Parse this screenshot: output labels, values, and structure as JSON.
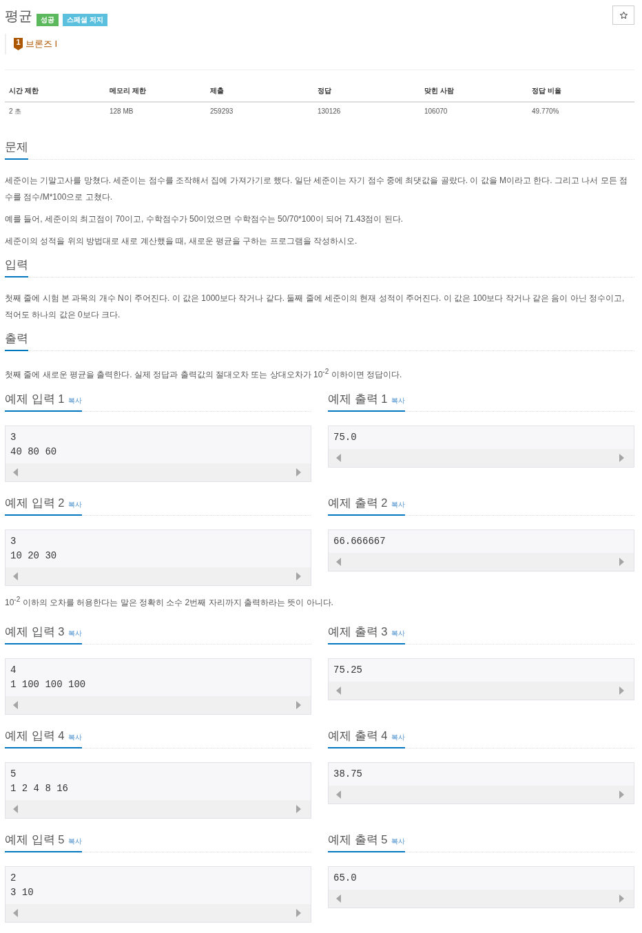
{
  "header": {
    "title": "평균",
    "badges": [
      {
        "label": "성공",
        "kind": "success"
      },
      {
        "label": "스페셜 저지",
        "kind": "info"
      }
    ],
    "starred": false
  },
  "tier": {
    "number": "1",
    "label": "브론즈 I"
  },
  "stats": {
    "columns": [
      "시간 제한",
      "메모리 제한",
      "제출",
      "정답",
      "맞힌 사람",
      "정답 비율"
    ],
    "rows": [
      [
        "2 초",
        "128 MB",
        "259293",
        "130126",
        "106070",
        "49.770%"
      ]
    ]
  },
  "sections": [
    {
      "title": "문제",
      "paragraphs": [
        "세준이는 기말고사를 망쳤다. 세준이는 점수를 조작해서 집에 가져가기로 했다. 일단 세준이는 자기 점수 중에 최댓값을 골랐다. 이 값을 M이라고 한다. 그리고 나서 모든 점수를 점수/M*100으로 고쳤다.",
        "예를 들어, 세준이의 최고점이 70이고, 수학점수가 50이었으면 수학점수는 50/70*100이 되어 71.43점이 된다.",
        "세준이의 성적을 위의 방법대로 새로 계산했을 때, 새로운 평균을 구하는 프로그램을 작성하시오."
      ]
    },
    {
      "title": "입력",
      "paragraphs": [
        "첫째 줄에 시험 본 과목의 개수 N이 주어진다. 이 값은 1000보다 작거나 같다. 둘째 줄에 세준이의 현재 성적이 주어진다. 이 값은 100보다 작거나 같은 음이 아닌 정수이고, 적어도 하나의 값은 0보다 크다."
      ]
    },
    {
      "title": "출력",
      "paragraphs": [
        "첫째 줄에 새로운 평균을 출력한다. 실제 정답과 출력값의 절대오차 또는 상대오차가 10$^{-2}$ 이하이면 정답이다."
      ]
    }
  ],
  "samples": [
    {
      "kind": "pair",
      "input": {
        "title": "예제 입력 1",
        "copy": "복사",
        "text": "3\n40 80 60"
      },
      "output": {
        "title": "예제 출력 1",
        "copy": "복사",
        "text": "75.0"
      }
    },
    {
      "kind": "pair",
      "input": {
        "title": "예제 입력 2",
        "copy": "복사",
        "text": "3\n10 20 30"
      },
      "output": {
        "title": "예제 출력 2",
        "copy": "복사",
        "text": "66.666667"
      }
    },
    {
      "kind": "note",
      "text": "10$^{-2}$ 이하의 오차를 허용한다는 말은 정확히 소수 2번째 자리까지 출력하라는 뜻이 아니다."
    },
    {
      "kind": "pair",
      "input": {
        "title": "예제 입력 3",
        "copy": "복사",
        "text": "4\n1 100 100 100"
      },
      "output": {
        "title": "예제 출력 3",
        "copy": "복사",
        "text": "75.25"
      }
    },
    {
      "kind": "pair",
      "input": {
        "title": "예제 입력 4",
        "copy": "복사",
        "text": "5\n1 2 4 8 16"
      },
      "output": {
        "title": "예제 출력 4",
        "copy": "복사",
        "text": "38.75"
      }
    },
    {
      "kind": "pair",
      "input": {
        "title": "예제 입력 5",
        "copy": "복사",
        "text": "2\n3 10"
      },
      "output": {
        "title": "예제 출력 5",
        "copy": "복사",
        "text": "65.0"
      }
    }
  ]
}
